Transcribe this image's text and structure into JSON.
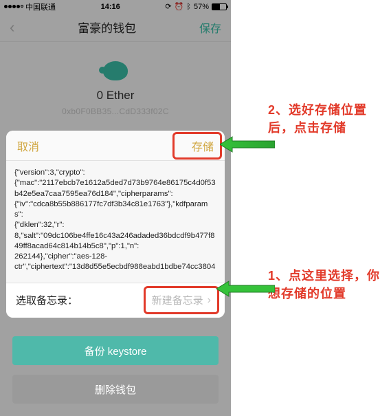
{
  "statusbar": {
    "carrier": "中国联通",
    "time": "14:16",
    "battery_pct": "57%"
  },
  "nav": {
    "title": "富豪的钱包",
    "save": "保存"
  },
  "wallet": {
    "balance": "0 Ether",
    "address": "0xb0F0BB35...CdD333f02C"
  },
  "modal": {
    "cancel": "取消",
    "store": "存储",
    "json_text": "{\"version\":3,\"crypto\":\n{\"mac\":\"2117ebcb7e1612a5ded7d73b9764e86175c4d0f53b42e5ea7caa7595ea76d184\",\"cipherparams\":\n{\"iv\":\"cdca8b55b886177fc7df3b34c81e1763\"},\"kdfparams\":\n{\"dklen\":32,\"r\":\n8,\"salt\":\"09dc106be4ffe16c43a246adaded36bdcdf9b477f849ff8acad64c814b14b5c8\",\"p\":1,\"n\":\n262144},\"cipher\":\"aes-128-\nctr\",\"ciphertext\":\"13d8d55e5ecbdf988eabd1bdbe74cc3804",
    "memo_label": "选取备忘录：",
    "memo_action": "新建备忘录"
  },
  "buttons": {
    "backup": "备份 keystore",
    "delete": "删除钱包"
  },
  "annotations": {
    "a2": "2、选好存储位置后，点击存储",
    "a1": "1、点这里选择，你想存储的位置"
  }
}
